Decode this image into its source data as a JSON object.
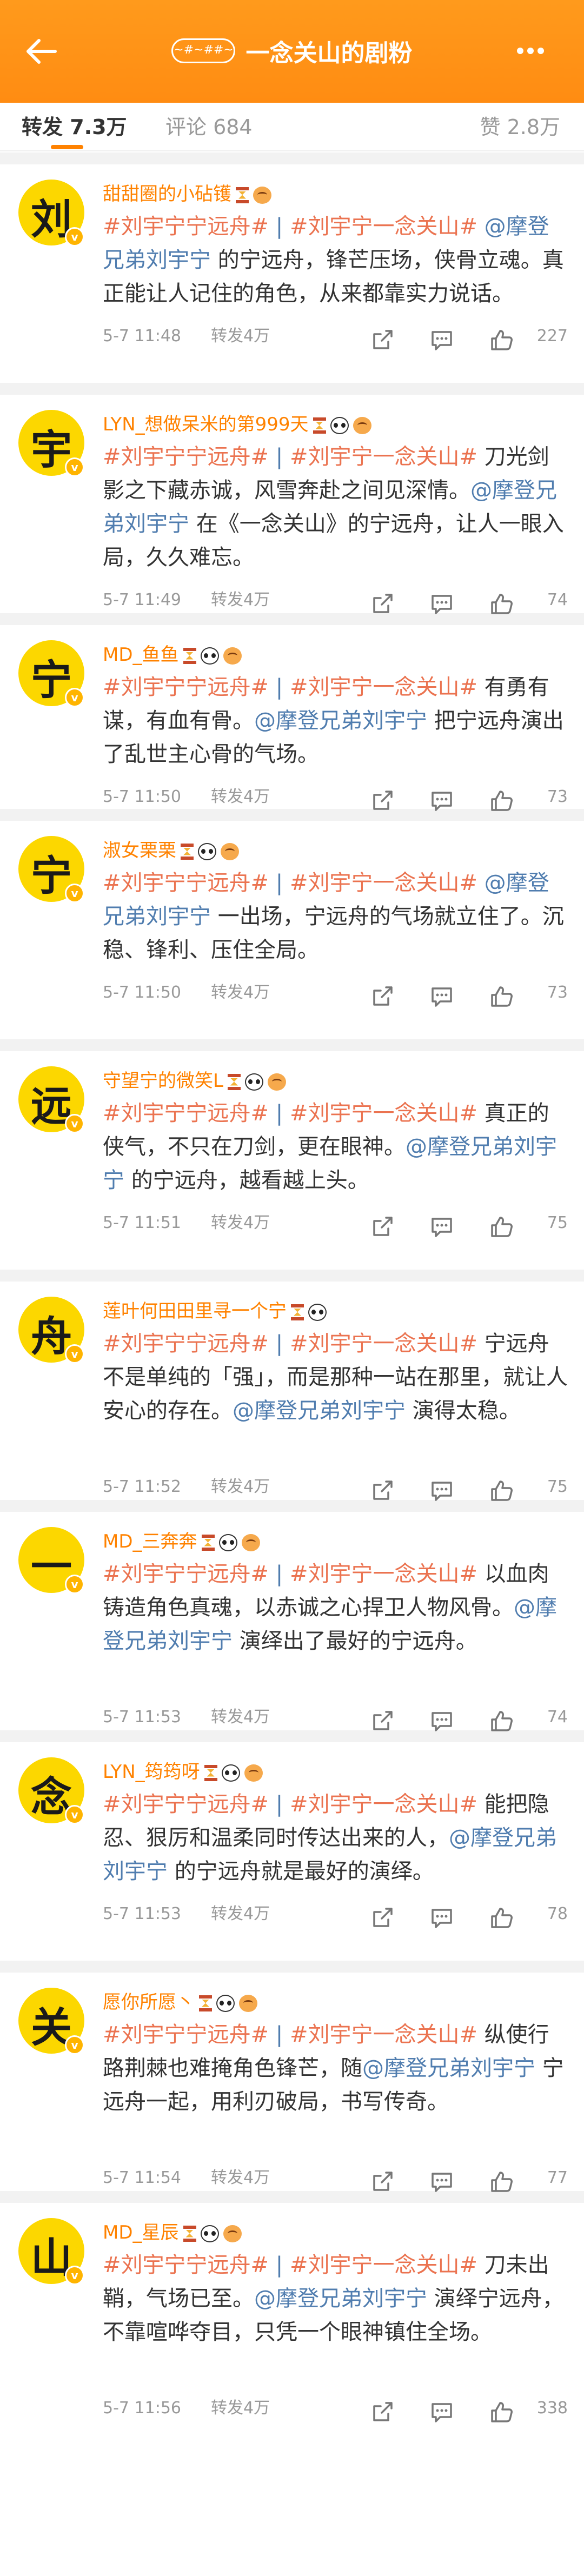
{
  "header": {
    "badge_text": "~#~##~",
    "title": "一念关山的剧粉",
    "back_icon": "back-arrow-icon",
    "more_icon": "more-dots-icon",
    "accent": "#ff8200"
  },
  "tabs": {
    "repost": "转发 7.3万",
    "comment": "评论 684",
    "like": "赞 2.8万"
  },
  "posts": [
    {
      "avatar_char": "刘",
      "name": "甜甜圈的小砧镬",
      "emojis": [
        "hourglass",
        "face"
      ],
      "segments": [
        [
          "tag",
          "#刘宇宁宁远舟#"
        ],
        [
          "div",
          " | "
        ],
        [
          "tag",
          "#刘宇宁一念关山#"
        ],
        [
          "lnk",
          " @摩登兄弟刘宇宁"
        ],
        [
          "txt",
          " 的宁远舟，锋芒压场，侠骨立魂。真正能让人记住的角色，从来都靠实力说话。"
        ]
      ],
      "time": "5-7 11:48",
      "repost": "转发4万",
      "likes": "227"
    },
    {
      "avatar_char": "宇",
      "name": "LYN_想做呆米的第999天",
      "emojis": [
        "hourglass",
        "panda",
        "face"
      ],
      "segments": [
        [
          "tag",
          "#刘宇宁宁远舟#"
        ],
        [
          "div",
          " | "
        ],
        [
          "tag",
          "#刘宇宁一念关山#"
        ],
        [
          "txt",
          " 刀光剑影之下藏赤诚，风雪奔赴之间见深情。"
        ],
        [
          "lnk",
          "@摩登兄弟刘宇宁"
        ],
        [
          "txt",
          " 在《一念关山》的宁远舟，让人一眼入局，久久难忘。"
        ]
      ],
      "time": "5-7 11:49",
      "repost": "转发4万",
      "likes": "74"
    },
    {
      "avatar_char": "宁",
      "name": "MD_鱼鱼",
      "emojis": [
        "hourglass",
        "panda",
        "face"
      ],
      "segments": [
        [
          "tag",
          "#刘宇宁宁远舟#"
        ],
        [
          "div",
          " | "
        ],
        [
          "tag",
          "#刘宇宁一念关山#"
        ],
        [
          "txt",
          " 有勇有谋，有血有骨。"
        ],
        [
          "lnk",
          "@摩登兄弟刘宇宁"
        ],
        [
          "txt",
          " 把宁远舟演出了乱世主心骨的气场。"
        ]
      ],
      "time": "5-7 11:50",
      "repost": "转发4万",
      "likes": "73"
    },
    {
      "avatar_char": "宁",
      "name": "淑女栗栗",
      "emojis": [
        "hourglass",
        "panda",
        "face"
      ],
      "segments": [
        [
          "tag",
          "#刘宇宁宁远舟#"
        ],
        [
          "div",
          " | "
        ],
        [
          "tag",
          "#刘宇宁一念关山#"
        ],
        [
          "lnk",
          " @摩登兄弟刘宇宁"
        ],
        [
          "txt",
          " 一出场，宁远舟的气场就立住了。沉稳、锋利、压住全局。"
        ]
      ],
      "time": "5-7 11:50",
      "repost": "转发4万",
      "likes": "73"
    },
    {
      "avatar_char": "远",
      "name": "守望宁的微笑L",
      "emojis": [
        "hourglass",
        "panda",
        "face"
      ],
      "segments": [
        [
          "tag",
          "#刘宇宁宁远舟#"
        ],
        [
          "div",
          " | "
        ],
        [
          "tag",
          "#刘宇宁一念关山#"
        ],
        [
          "txt",
          " 真正的侠气，不只在刀剑，更在眼神。"
        ],
        [
          "lnk",
          "@摩登兄弟刘宇宁"
        ],
        [
          "txt",
          " 的宁远舟，越看越上头。"
        ]
      ],
      "time": "5-7 11:51",
      "repost": "转发4万",
      "likes": "75"
    },
    {
      "avatar_char": "舟",
      "name": "莲叶何田田里寻一个宁",
      "emojis": [
        "hourglass",
        "panda"
      ],
      "segments": [
        [
          "tag",
          "#刘宇宁宁远舟#"
        ],
        [
          "div",
          " | "
        ],
        [
          "tag",
          "#刘宇宁一念关山#"
        ],
        [
          "txt",
          " 宁远舟不是单纯的「强」，而是那种一站在那里，就让人安心的存在。"
        ],
        [
          "lnk",
          "@摩登兄弟刘宇宁"
        ],
        [
          "txt",
          " 演得太稳。"
        ]
      ],
      "time": "5-7 11:52",
      "repost": "转发4万",
      "likes": "75"
    },
    {
      "avatar_char": "一",
      "name": "MD_三奔奔",
      "emojis": [
        "hourglass",
        "panda",
        "face"
      ],
      "segments": [
        [
          "tag",
          "#刘宇宁宁远舟#"
        ],
        [
          "div",
          " | "
        ],
        [
          "tag",
          "#刘宇宁一念关山#"
        ],
        [
          "txt",
          " 以血肉铸造角色真魂，以赤诚之心捍卫人物风骨。"
        ],
        [
          "lnk",
          "@摩登兄弟刘宇宁"
        ],
        [
          "txt",
          " 演绎出了最好的宁远舟。"
        ]
      ],
      "time": "5-7 11:53",
      "repost": "转发4万",
      "likes": "74"
    },
    {
      "avatar_char": "念",
      "name": "LYN_筠筠呀",
      "emojis": [
        "hourglass",
        "panda",
        "face"
      ],
      "segments": [
        [
          "tag",
          "#刘宇宁宁远舟#"
        ],
        [
          "div",
          " | "
        ],
        [
          "tag",
          "#刘宇宁一念关山#"
        ],
        [
          "txt",
          " 能把隐忍、狠厉和温柔同时传达出来的人，"
        ],
        [
          "lnk",
          "@摩登兄弟刘宇宁"
        ],
        [
          "txt",
          " 的宁远舟就是最好的演绎。"
        ]
      ],
      "time": "5-7 11:53",
      "repost": "转发4万",
      "likes": "78"
    },
    {
      "avatar_char": "关",
      "name": "愿你所愿丶",
      "emojis": [
        "hourglass",
        "panda",
        "face"
      ],
      "segments": [
        [
          "tag",
          "#刘宇宁宁远舟#"
        ],
        [
          "div",
          " | "
        ],
        [
          "tag",
          "#刘宇宁一念关山#"
        ],
        [
          "txt",
          " 纵使行路荆棘也难掩角色锋芒，随"
        ],
        [
          "lnk",
          "@摩登兄弟刘宇宁"
        ],
        [
          "txt",
          " 宁远舟一起，用利刃破局，书写传奇。"
        ]
      ],
      "time": "5-7 11:54",
      "repost": "转发4万",
      "likes": "77"
    },
    {
      "avatar_char": "山",
      "name": "MD_星辰",
      "emojis": [
        "hourglass",
        "panda",
        "face"
      ],
      "segments": [
        [
          "tag",
          "#刘宇宁宁远舟#"
        ],
        [
          "div",
          " | "
        ],
        [
          "tag",
          "#刘宇宁一念关山#"
        ],
        [
          "txt",
          " 刀未出鞘，气场已至。"
        ],
        [
          "lnk",
          "@摩登兄弟刘宇宁"
        ],
        [
          "txt",
          " 演绎宁远舟，不靠喧哗夺目，只凭一个眼神镇住全场。"
        ]
      ],
      "time": "5-7 11:56",
      "repost": "转发4万",
      "likes": "338"
    }
  ],
  "action_icons": [
    "share-icon",
    "comment-icon",
    "like-icon"
  ]
}
